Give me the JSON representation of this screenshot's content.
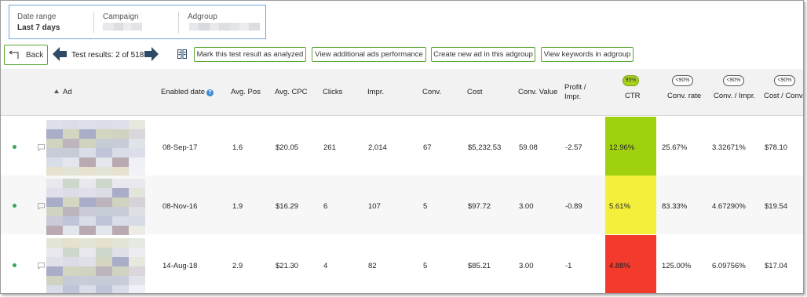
{
  "filters": {
    "date_range": {
      "label": "Date range",
      "value": "Last 7 days"
    },
    "campaign": {
      "label": "Campaign",
      "value": ""
    },
    "adgroup": {
      "label": "Adgroup",
      "value": ""
    }
  },
  "toolbar": {
    "back_label": "Back",
    "test_results_text": "Test results: 2 of 518",
    "mark_analyzed_label": "Mark this test result as analyzed",
    "view_additional_label": "View additional ads performance",
    "create_ad_label": "Create new ad in this adgroup",
    "view_keywords_label": "View keywords in adgroup"
  },
  "table": {
    "headers": {
      "ad": "Ad",
      "enabled_date": "Enabled date",
      "avg_pos": "Avg. Pos",
      "avg_cpc": "Avg. CPC",
      "clicks": "Clicks",
      "impr": "Impr.",
      "conv": "Conv.",
      "cost": "Cost",
      "conv_value": "Conv. Value",
      "profit_line1": "Profit /",
      "profit_line2": "Impr.",
      "ctr": "CTR",
      "conv_rate": "Conv. rate",
      "conv_impr": "Conv. / Impr.",
      "cost_conv": "Cost / Conv."
    },
    "badges": {
      "ctr": "95%",
      "conv_rate": "<90%",
      "conv_impr": "<90%",
      "cost_conv": "<90%"
    },
    "rows": [
      {
        "enabled_date": "08-Sep-17",
        "avg_pos": "1.6",
        "avg_cpc": "$20.05",
        "clicks": "261",
        "impr": "2,014",
        "conv": "67",
        "cost": "$5,232.53",
        "conv_value": "59.08",
        "profit_impr": "-2.57",
        "ctr": "12.96%",
        "conv_rate": "25.67%",
        "conv_impr": "3.32671%",
        "cost_conv": "$78.10",
        "ctr_color": "#9fd10f"
      },
      {
        "enabled_date": "08-Nov-16",
        "avg_pos": "1.9",
        "avg_cpc": "$16.29",
        "clicks": "6",
        "impr": "107",
        "conv": "5",
        "cost": "$97.72",
        "conv_value": "3.00",
        "profit_impr": "-0.89",
        "ctr": "5.61%",
        "conv_rate": "83.33%",
        "conv_impr": "4.67290%",
        "cost_conv": "$19.54",
        "ctr_color": "#f4ef3a"
      },
      {
        "enabled_date": "14-Aug-18",
        "avg_pos": "2.9",
        "avg_cpc": "$21.30",
        "clicks": "4",
        "impr": "82",
        "conv": "5",
        "cost": "$85.21",
        "conv_value": "3.00",
        "profit_impr": "-1",
        "ctr": "4.88%",
        "conv_rate": "125.00%",
        "conv_impr": "6.09756%",
        "cost_conv": "$17.04",
        "ctr_color": "#f23b2c"
      }
    ]
  },
  "colors": {
    "accent_green": "#5aa832",
    "filter_border": "#6fa8dc",
    "status_dot": "#3aa655",
    "nav_arrow": "#2d4a66"
  },
  "icons": [
    "back-arrow-icon",
    "left-arrow-icon",
    "right-arrow-icon",
    "columns-icon",
    "help-icon",
    "sort-asc-icon",
    "status-dot-icon",
    "comment-icon"
  ]
}
